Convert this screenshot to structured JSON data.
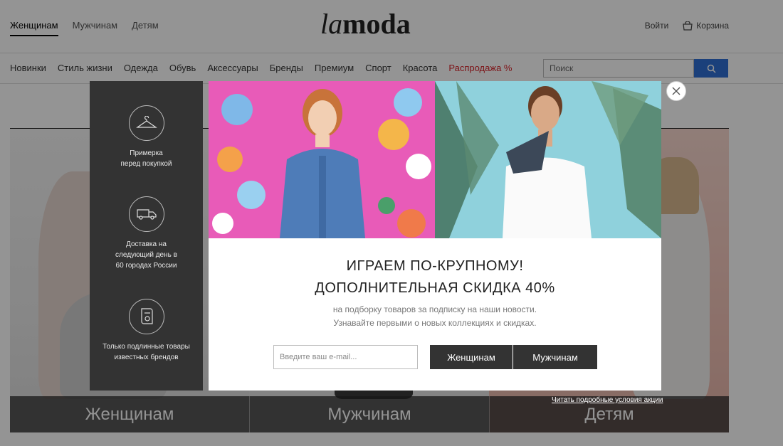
{
  "header": {
    "gender_tabs": [
      "Женщинам",
      "Мужчинам",
      "Детям"
    ],
    "logo_light": "la",
    "logo_bold": "moda",
    "login": "Войти",
    "cart": "Корзина"
  },
  "nav": {
    "categories": [
      "Новинки",
      "Стиль жизни",
      "Одежда",
      "Обувь",
      "Аксессуары",
      "Бренды",
      "Премиум",
      "Спорт",
      "Красота"
    ],
    "sale": "Распродажа %",
    "search_placeholder": "Поиск"
  },
  "hero": {
    "labels": [
      "Женщинам",
      "Мужчинам",
      "Детям"
    ]
  },
  "side_panel": {
    "features": [
      {
        "line1": "Примерка",
        "line2": "перед покупкой",
        "line3": ""
      },
      {
        "line1": "Доставка на",
        "line2": "следующий день в",
        "line3": "60 городах России"
      },
      {
        "line1": "Только подлинные товары",
        "line2": "известных брендов",
        "line3": ""
      }
    ]
  },
  "modal": {
    "title_line1": "ИГРАЕМ ПО-КРУПНОМУ!",
    "title_line2": "ДОПОЛНИТЕЛЬНАЯ СКИДКА 40%",
    "subtitle_line1": "на подборку товаров за подписку на наши новости.",
    "subtitle_line2": "Узнавайте первыми о новых коллекциях и скидках.",
    "email_placeholder": "Введите ваш e-mail...",
    "women_button": "Женщинам",
    "men_button": "Мужчинам",
    "terms_link": "Читать подробные условия акции"
  },
  "colors": {
    "accent_blue": "#2f6fd4",
    "sale_red": "#d8232a",
    "dark_panel": "#333333"
  },
  "icons": [
    "search-icon",
    "cart-icon",
    "close-icon",
    "hanger-icon",
    "truck-icon",
    "certificate-icon"
  ]
}
